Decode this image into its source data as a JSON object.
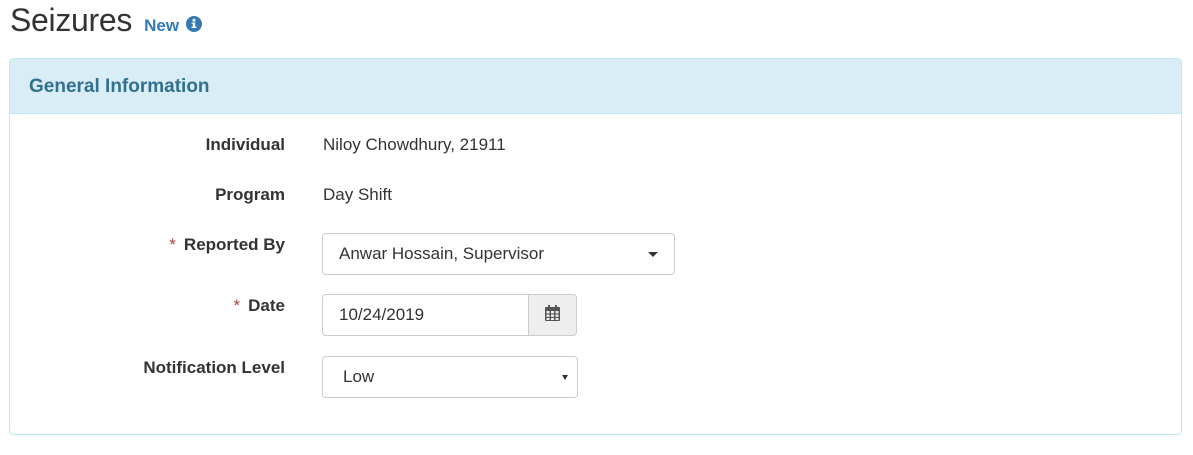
{
  "header": {
    "title": "Seizures",
    "badge": "New"
  },
  "panel": {
    "title": "General Information"
  },
  "form": {
    "individual": {
      "label": "Individual",
      "value": "Niloy Chowdhury, 21911"
    },
    "program": {
      "label": "Program",
      "value": "Day Shift"
    },
    "reported_by": {
      "label": "Reported By",
      "required": "*",
      "selected": "Anwar Hossain, Supervisor"
    },
    "date": {
      "label": "Date",
      "required": "*",
      "value": "10/24/2019"
    },
    "notification_level": {
      "label": "Notification Level",
      "selected": "Low"
    }
  },
  "icons": {
    "info": "info-circle-icon",
    "calendar": "calendar-icon",
    "reported_by_caret": "caret-down-icon",
    "notification_caret": "caret-down-icon"
  },
  "colors": {
    "panel_heading_bg": "#d9edf7",
    "panel_border": "#bce8f1",
    "panel_title": "#31708f",
    "link_blue": "#337ab7",
    "required_red": "#a94442"
  }
}
